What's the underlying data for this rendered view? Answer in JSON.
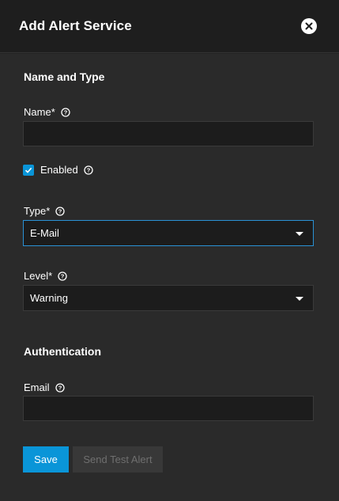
{
  "dialog": {
    "title": "Add Alert Service",
    "close_icon": "close-icon"
  },
  "sections": {
    "name_and_type": "Name and Type",
    "authentication": "Authentication"
  },
  "fields": {
    "name": {
      "label": "Name",
      "required_mark": "*",
      "value": "",
      "help_icon": "help-circle-icon"
    },
    "enabled": {
      "label": "Enabled",
      "checked": true,
      "help_icon": "help-circle-icon"
    },
    "type": {
      "label": "Type",
      "required_mark": "*",
      "value": "E-Mail",
      "focused": true,
      "help_icon": "help-circle-icon"
    },
    "level": {
      "label": "Level",
      "required_mark": "*",
      "value": "Warning",
      "help_icon": "help-circle-icon"
    },
    "email": {
      "label": "Email",
      "value": "",
      "help_icon": "help-circle-icon"
    }
  },
  "buttons": {
    "save": "Save",
    "send_test_alert": "Send Test Alert"
  },
  "colors": {
    "accent": "#0a95d8",
    "focus_border": "#2a92d6",
    "background": "#2a2a2a",
    "header_background": "#1e1e1e"
  }
}
